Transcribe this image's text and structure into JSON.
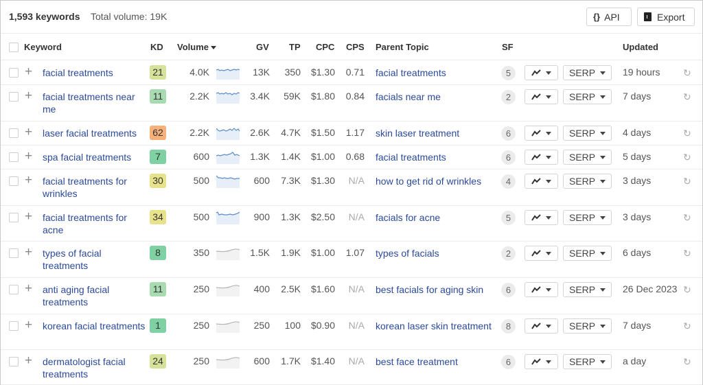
{
  "header": {
    "keyword_count": "1,593 keywords",
    "total_volume": "Total volume: 19K",
    "api_button": "API",
    "api_icon": "{}",
    "export_button": "Export"
  },
  "columns": {
    "keyword": "Keyword",
    "kd": "KD",
    "volume": "Volume",
    "gv": "GV",
    "tp": "TP",
    "cpc": "CPC",
    "cps": "CPS",
    "parent_topic": "Parent Topic",
    "sf": "SF",
    "updated": "Updated"
  },
  "kd_colors": {
    "very_easy": "#7fd0a3",
    "easy": "#a8dbb1",
    "medium_low": "#d6e29a",
    "medium": "#e7e38c",
    "hard": "#f7b07a"
  },
  "link_color": "#2b4a9a",
  "rows": [
    {
      "keyword": "facial treatments",
      "kd": "21",
      "kd_level": "medium_low",
      "volume": "4.0K",
      "trend": "active",
      "gv": "13K",
      "tp": "350",
      "cpc": "$1.30",
      "cps": "0.71",
      "parent_topic": "facial treatments",
      "sf": "5",
      "trend_btn": "trend",
      "serp": "SERP",
      "updated": "19 hours"
    },
    {
      "keyword": "facial treatments near me",
      "kd": "11",
      "kd_level": "easy",
      "volume": "2.2K",
      "trend": "active",
      "gv": "3.4K",
      "tp": "59K",
      "cpc": "$1.80",
      "cps": "0.84",
      "parent_topic": "facials near me",
      "sf": "2",
      "trend_btn": "trend",
      "serp": "SERP",
      "updated": "7 days"
    },
    {
      "keyword": "laser facial treatments",
      "kd": "62",
      "kd_level": "hard",
      "volume": "2.2K",
      "trend": "active",
      "gv": "2.6K",
      "tp": "4.7K",
      "cpc": "$1.50",
      "cps": "1.17",
      "parent_topic": "skin laser treatment",
      "sf": "6",
      "trend_btn": "trend",
      "serp": "SERP",
      "updated": "4 days"
    },
    {
      "keyword": "spa facial treatments",
      "kd": "7",
      "kd_level": "very_easy",
      "volume": "600",
      "trend": "active",
      "gv": "1.3K",
      "tp": "1.4K",
      "cpc": "$1.00",
      "cps": "0.68",
      "parent_topic": "facial treatments",
      "sf": "6",
      "trend_btn": "trend",
      "serp": "SERP",
      "updated": "5 days"
    },
    {
      "keyword": "facial treatments for wrinkles",
      "kd": "30",
      "kd_level": "medium",
      "volume": "500",
      "trend": "active",
      "gv": "600",
      "tp": "7.3K",
      "cpc": "$1.30",
      "cps": "N/A",
      "parent_topic": "how to get rid of wrinkles",
      "sf": "4",
      "trend_btn": "trend",
      "serp": "SERP",
      "updated": "3 days"
    },
    {
      "keyword": "facial treatments for acne",
      "kd": "34",
      "kd_level": "medium",
      "volume": "500",
      "trend": "active",
      "gv": "900",
      "tp": "1.3K",
      "cpc": "$2.50",
      "cps": "N/A",
      "parent_topic": "facials for acne",
      "sf": "5",
      "trend_btn": "trend",
      "serp": "SERP",
      "updated": "3 days"
    },
    {
      "keyword": "types of facial treatments",
      "kd": "8",
      "kd_level": "very_easy",
      "volume": "350",
      "trend": "flat",
      "gv": "1.5K",
      "tp": "1.9K",
      "cpc": "$1.00",
      "cps": "1.07",
      "parent_topic": "types of facials",
      "sf": "2",
      "trend_btn": "trend",
      "serp": "SERP",
      "updated": "6 days"
    },
    {
      "keyword": "anti aging facial treatments",
      "kd": "11",
      "kd_level": "easy",
      "volume": "250",
      "trend": "flat",
      "gv": "400",
      "tp": "2.5K",
      "cpc": "$1.60",
      "cps": "N/A",
      "parent_topic": "best facials for aging skin",
      "sf": "6",
      "trend_btn": "trend",
      "serp": "SERP",
      "updated": "26 Dec 2023"
    },
    {
      "keyword": "korean facial treatments",
      "kd": "1",
      "kd_level": "very_easy",
      "volume": "250",
      "trend": "flat",
      "gv": "250",
      "tp": "100",
      "cpc": "$0.90",
      "cps": "N/A",
      "parent_topic": "korean laser skin treatment",
      "sf": "8",
      "trend_btn": "trend",
      "serp": "SERP",
      "updated": "7 days"
    },
    {
      "keyword": "dermatologist facial treatments",
      "kd": "24",
      "kd_level": "medium_low",
      "volume": "250",
      "trend": "flat",
      "gv": "600",
      "tp": "1.7K",
      "cpc": "$1.40",
      "cps": "N/A",
      "parent_topic": "best face treatment",
      "sf": "6",
      "trend_btn": "trend",
      "serp": "SERP",
      "updated": "a day"
    }
  ]
}
